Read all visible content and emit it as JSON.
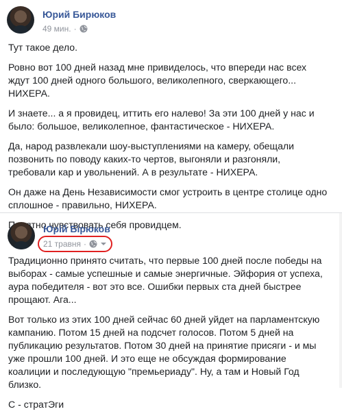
{
  "post": {
    "author": "Юрий Бирюков",
    "time": "49 мин.",
    "paragraphs": [
      "Тут такое дело.",
      "Ровно вот 100 дней назад мне привиделось, что впереди нас всех ждут 100 дней одного большого, великолепного, сверкающего... НИХЕРА.",
      "И знаете... а я провидец, иттить его налево! За эти 100 дней у нас и было: большое, великолепное, фантастическое - НИХЕРА.",
      "Да, народ развлекали шоу-выступлениями на камеру, обещали позвонить по поводу каких-то чертов, выгоняли и разгоняли, требовали кар и увольнений. А в результате - НИХЕРА.",
      "Он даже на День Независимости смог устроить в центре столице одно сплошное - правильно, НИХЕРА.",
      "Приятно чувствовать себя провидцем."
    ]
  },
  "shared_post": {
    "author": "Юрій Бірюков",
    "date": "21 травня",
    "paragraphs": [
      "Традиционно принято считать, что первые 100 дней после победы на выборах - самые успешные и самые энергичные. Эйфория от успеха, аура победителя - вот это все. Ошибки первых ста дней быстрее прощают. Ага...",
      "Вот только из этих 100 дней сейчас 60 дней уйдет на парламентскую кампанию. Потом 15 дней на подсчет голосов. Потом 5 дней на публикацию результатов. Потом 30 дней на принятие присяги - и мы уже прошли 100 дней. И это еще не обсуждая формирование коалиции и последующую \"премьериаду\". Ну, а там и Новый Год близко.",
      "С - стратЭги"
    ]
  },
  "colors": {
    "link": "#385898",
    "meta": "#90949c",
    "highlight": "#e02020"
  },
  "icons": [
    "globe-icon",
    "chevron-down-icon"
  ]
}
